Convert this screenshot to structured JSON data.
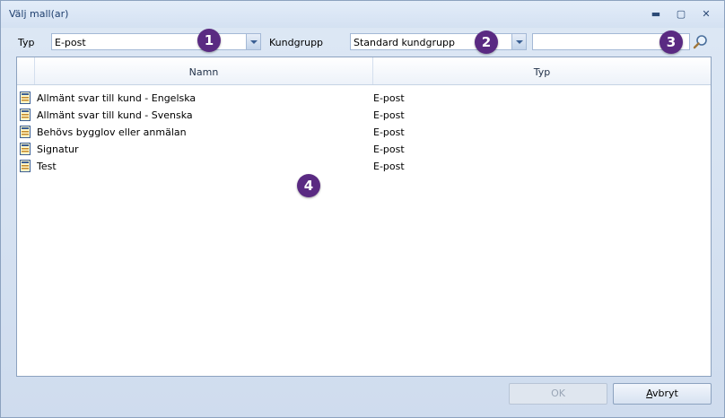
{
  "window": {
    "title": "Välj mall(ar)",
    "minimize_glyph": "▬",
    "maximize_glyph": "▢",
    "close_glyph": "✕"
  },
  "filters": {
    "type_label": "Typ",
    "type_value": "E-post",
    "customer_group_label": "Kundgrupp",
    "customer_group_value": "Standard kundgrupp",
    "search_value": "",
    "search_icon": "magnifier-icon"
  },
  "badges": [
    "1",
    "2",
    "3",
    "4"
  ],
  "grid": {
    "columns": [
      "Namn",
      "Typ"
    ],
    "rows": [
      {
        "name": "Allmänt svar till kund - Engelska",
        "type": "E-post"
      },
      {
        "name": "Allmänt svar till kund - Svenska",
        "type": "E-post"
      },
      {
        "name": "Behövs bygglov eller anmälan",
        "type": "E-post"
      },
      {
        "name": "Signatur",
        "type": "E-post"
      },
      {
        "name": "Test",
        "type": "E-post"
      }
    ]
  },
  "footer": {
    "ok_label": "OK",
    "cancel_label": "Avbryt"
  },
  "colors": {
    "badge": "#5a2a82",
    "title_text": "#1e3f6e"
  }
}
